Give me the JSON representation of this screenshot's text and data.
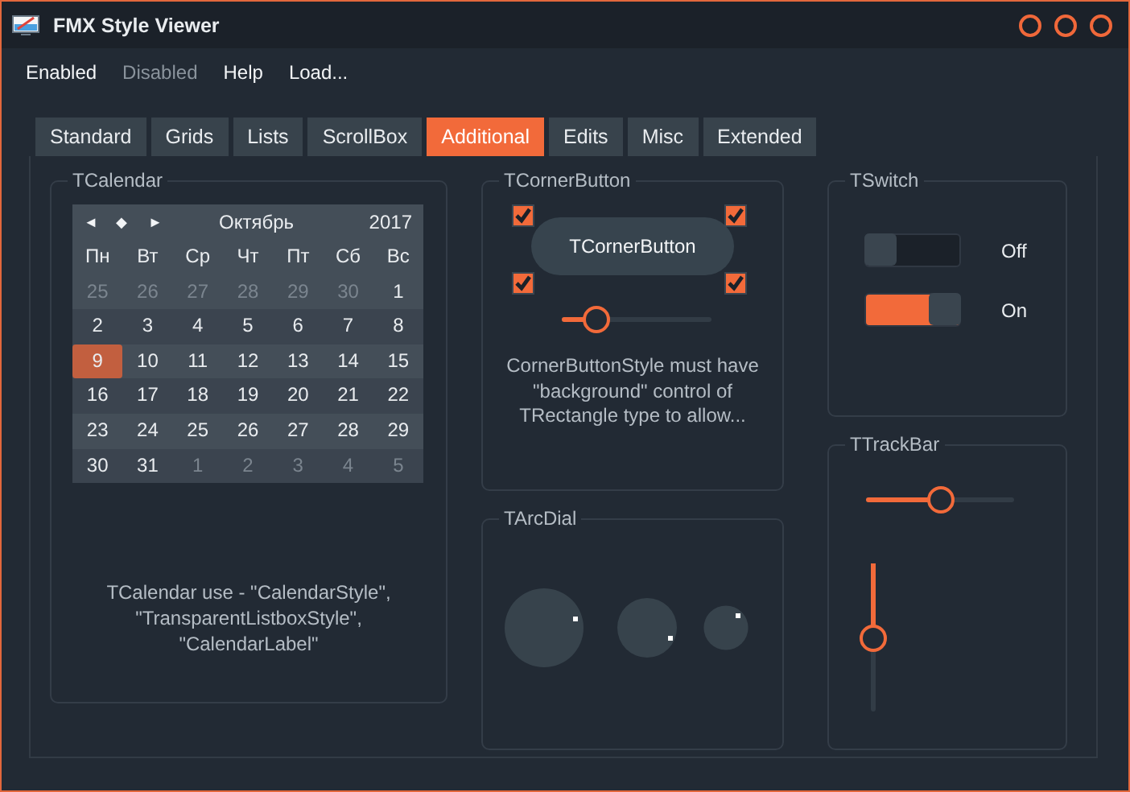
{
  "window": {
    "title": "FMX Style Viewer"
  },
  "menu": [
    {
      "label": "Enabled",
      "disabled": false
    },
    {
      "label": "Disabled",
      "disabled": true
    },
    {
      "label": "Help",
      "disabled": false
    },
    {
      "label": "Load...",
      "disabled": false
    }
  ],
  "tabs": [
    {
      "label": "Standard",
      "selected": false
    },
    {
      "label": "Grids",
      "selected": false
    },
    {
      "label": "Lists",
      "selected": false
    },
    {
      "label": "ScrollBox",
      "selected": false
    },
    {
      "label": "Additional",
      "selected": true
    },
    {
      "label": "Edits",
      "selected": false
    },
    {
      "label": "Misc",
      "selected": false
    },
    {
      "label": "Extended",
      "selected": false
    }
  ],
  "calendar": {
    "title": "TCalendar",
    "prev": "◄",
    "today": "◆",
    "next": "►",
    "month": "Октябрь",
    "year": "2017",
    "weekdays": [
      "Пн",
      "Вт",
      "Ср",
      "Чт",
      "Пт",
      "Сб",
      "Вс"
    ],
    "weeks": [
      [
        {
          "day": "25",
          "current_month": false,
          "selected": false
        },
        {
          "day": "26",
          "current_month": false,
          "selected": false
        },
        {
          "day": "27",
          "current_month": false,
          "selected": false
        },
        {
          "day": "28",
          "current_month": false,
          "selected": false
        },
        {
          "day": "29",
          "current_month": false,
          "selected": false
        },
        {
          "day": "30",
          "current_month": false,
          "selected": false
        },
        {
          "day": "1",
          "current_month": true,
          "selected": false
        }
      ],
      [
        {
          "day": "2",
          "current_month": true,
          "selected": false
        },
        {
          "day": "3",
          "current_month": true,
          "selected": false
        },
        {
          "day": "4",
          "current_month": true,
          "selected": false
        },
        {
          "day": "5",
          "current_month": true,
          "selected": false
        },
        {
          "day": "6",
          "current_month": true,
          "selected": false
        },
        {
          "day": "7",
          "current_month": true,
          "selected": false
        },
        {
          "day": "8",
          "current_month": true,
          "selected": false
        }
      ],
      [
        {
          "day": "9",
          "current_month": true,
          "selected": true
        },
        {
          "day": "10",
          "current_month": true,
          "selected": false
        },
        {
          "day": "11",
          "current_month": true,
          "selected": false
        },
        {
          "day": "12",
          "current_month": true,
          "selected": false
        },
        {
          "day": "13",
          "current_month": true,
          "selected": false
        },
        {
          "day": "14",
          "current_month": true,
          "selected": false
        },
        {
          "day": "15",
          "current_month": true,
          "selected": false
        }
      ],
      [
        {
          "day": "16",
          "current_month": true,
          "selected": false
        },
        {
          "day": "17",
          "current_month": true,
          "selected": false
        },
        {
          "day": "18",
          "current_month": true,
          "selected": false
        },
        {
          "day": "19",
          "current_month": true,
          "selected": false
        },
        {
          "day": "20",
          "current_month": true,
          "selected": false
        },
        {
          "day": "21",
          "current_month": true,
          "selected": false
        },
        {
          "day": "22",
          "current_month": true,
          "selected": false
        }
      ],
      [
        {
          "day": "23",
          "current_month": true,
          "selected": false
        },
        {
          "day": "24",
          "current_month": true,
          "selected": false
        },
        {
          "day": "25",
          "current_month": true,
          "selected": false
        },
        {
          "day": "26",
          "current_month": true,
          "selected": false
        },
        {
          "day": "27",
          "current_month": true,
          "selected": false
        },
        {
          "day": "28",
          "current_month": true,
          "selected": false
        },
        {
          "day": "29",
          "current_month": true,
          "selected": false
        }
      ],
      [
        {
          "day": "30",
          "current_month": true,
          "selected": false
        },
        {
          "day": "31",
          "current_month": true,
          "selected": false
        },
        {
          "day": "1",
          "current_month": false,
          "selected": false
        },
        {
          "day": "2",
          "current_month": false,
          "selected": false
        },
        {
          "day": "3",
          "current_month": false,
          "selected": false
        },
        {
          "day": "4",
          "current_month": false,
          "selected": false
        },
        {
          "day": "5",
          "current_month": false,
          "selected": false
        }
      ]
    ],
    "note": "TCalendar use - \"CalendarStyle\", \"TransparentListboxStyle\", \"CalendarLabel\""
  },
  "corner_button": {
    "title": "TCornerButton",
    "button": "TCornerButton",
    "checkboxes": [
      {
        "checked": true
      },
      {
        "checked": true
      },
      {
        "checked": true
      },
      {
        "checked": true
      }
    ],
    "slider": {
      "level": 0.23
    },
    "note": "CornerButtonStyle must have \"background\" control of TRectangle type to allow..."
  },
  "arc_dial": {
    "title": "TArcDial"
  },
  "switch": {
    "title": "TSwitch",
    "items": [
      {
        "label": "Off",
        "on": false
      },
      {
        "label": "On",
        "on": true
      }
    ]
  },
  "trackbar": {
    "title": "TTrackBar",
    "horizontal": {
      "level": 0.5
    },
    "vertical": {
      "level": 0.5
    }
  }
}
